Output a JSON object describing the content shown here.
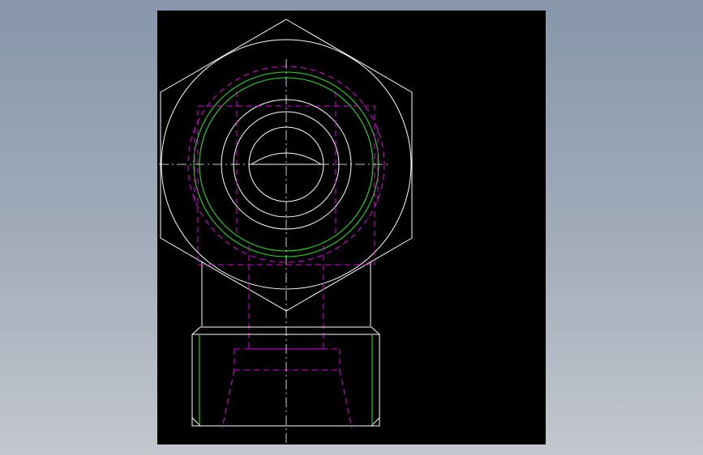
{
  "drawing": {
    "description_free": true,
    "colors": {
      "background": "#000000",
      "visible_edge": "#ffffff",
      "hidden_edge": "#e600e6",
      "thread_line": "#22dd22",
      "page_gradient_top": "#8796aa",
      "page_gradient_bottom": "#c3c7ce"
    },
    "icons": {
      "hex_nut": "hex-outline-icon",
      "circles": "concentric-circles-icon"
    }
  }
}
